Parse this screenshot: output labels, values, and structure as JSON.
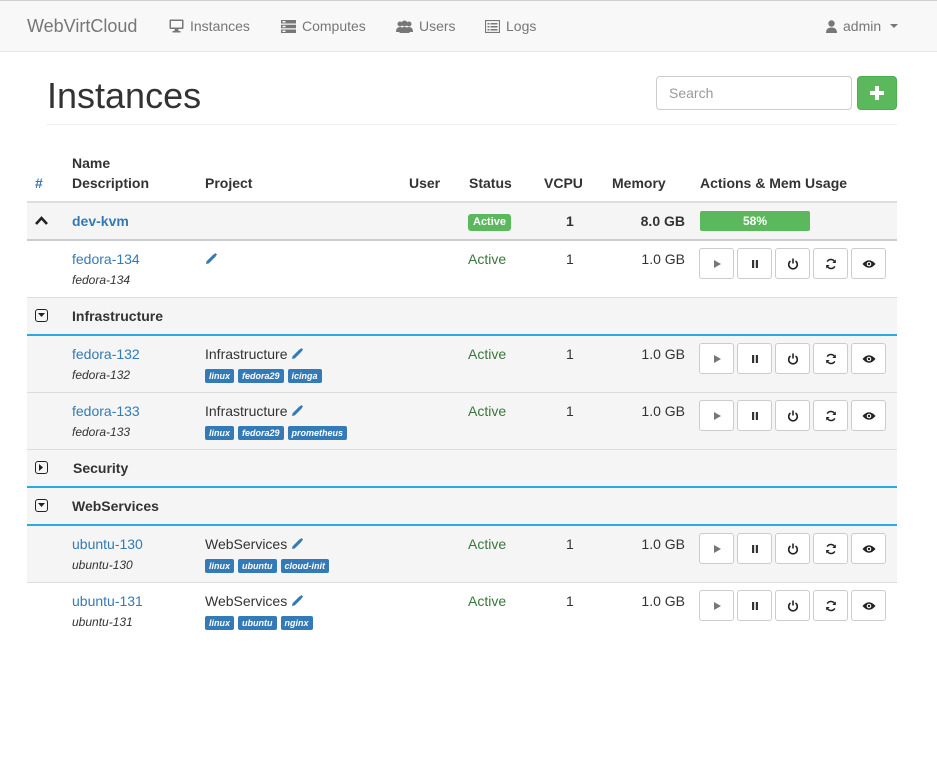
{
  "navbar": {
    "brand": "WebVirtCloud",
    "items": [
      {
        "label": "Instances",
        "icon": "monitor-icon"
      },
      {
        "label": "Computes",
        "icon": "server-icon"
      },
      {
        "label": "Users",
        "icon": "users-icon"
      },
      {
        "label": "Logs",
        "icon": "list-icon"
      }
    ],
    "user": {
      "label": "admin",
      "icon": "user-icon"
    }
  },
  "page": {
    "title": "Instances",
    "search_placeholder": "Search",
    "add_icon": "plus-icon"
  },
  "table": {
    "headers": {
      "hash": "#",
      "name": "Name",
      "description": "Description",
      "project": "Project",
      "user": "User",
      "status": "Status",
      "vcpu": "VCPU",
      "memory": "Memory",
      "actions": "Actions & Mem Usage"
    },
    "host": {
      "name": "dev-kvm",
      "status": "Active",
      "vcpu": "1",
      "memory": "8.0 GB",
      "mem_usage": "58%",
      "mem_usage_fraction": 0.58
    },
    "instances": [
      {
        "name": "fedora-134",
        "description": "fedora-134",
        "project": "",
        "tags": [],
        "status": "Active",
        "vcpu": "1",
        "memory": "1.0 GB"
      },
      {
        "name": "fedora-132",
        "description": "fedora-132",
        "project": "Infrastructure",
        "tags": [
          "linux",
          "fedora29",
          "icinga"
        ],
        "status": "Active",
        "vcpu": "1",
        "memory": "1.0 GB"
      },
      {
        "name": "fedora-133",
        "description": "fedora-133",
        "project": "Infrastructure",
        "tags": [
          "linux",
          "fedora29",
          "prometheus"
        ],
        "status": "Active",
        "vcpu": "1",
        "memory": "1.0 GB"
      },
      {
        "name": "ubuntu-130",
        "description": "ubuntu-130",
        "project": "WebServices",
        "tags": [
          "linux",
          "ubuntu",
          "cloud-init"
        ],
        "status": "Active",
        "vcpu": "1",
        "memory": "1.0 GB"
      },
      {
        "name": "ubuntu-131",
        "description": "ubuntu-131",
        "project": "WebServices",
        "tags": [
          "linux",
          "ubuntu",
          "nginx"
        ],
        "status": "Active",
        "vcpu": "1",
        "memory": "1.0 GB"
      }
    ],
    "groups": [
      {
        "name": "Infrastructure",
        "state": "collapse-icon"
      },
      {
        "name": "Security",
        "state": "expand-icon"
      },
      {
        "name": "WebServices",
        "state": "collapse-icon"
      }
    ],
    "action_icons": [
      "play-icon",
      "pause-icon",
      "power-icon",
      "refresh-icon",
      "eye-icon"
    ]
  },
  "colors": {
    "link": "#337ab7",
    "success": "#5cb85c",
    "status_text": "#3c763d",
    "group_border": "#29abe2"
  }
}
